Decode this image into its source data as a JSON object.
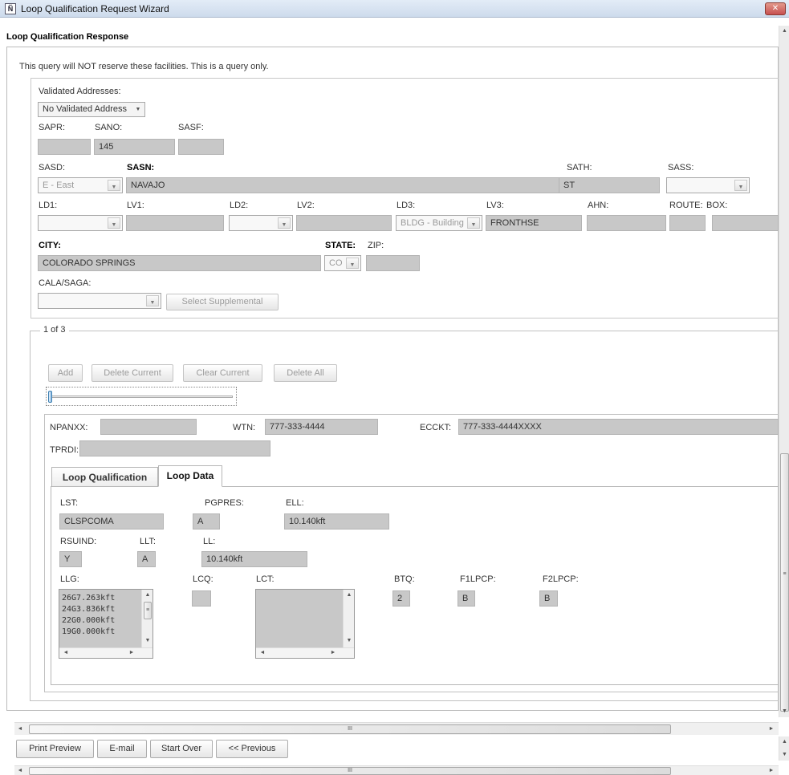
{
  "window": {
    "title": "Loop Qualification Request Wizard",
    "close_glyph": "✕"
  },
  "header": {
    "title": "Loop Qualification Response"
  },
  "notice": "This query will NOT reserve these facilities.  This is a query only.",
  "address": {
    "validated_label": "Validated Addresses:",
    "validated_value": "No Validated Address",
    "sapr_label": "SAPR:",
    "sapr_value": "",
    "sano_label": "SANO:",
    "sano_value": "145",
    "sasf_label": "SASF:",
    "sasf_value": "",
    "sasd_label": "SASD:",
    "sasd_value": "E - East",
    "sasn_label": "SASN:",
    "sasn_value": "NAVAJO",
    "sath_label": "SATH:",
    "sath_value": "ST",
    "sass_label": "SASS:",
    "sass_value": "",
    "ld1_label": "LD1:",
    "ld1_value": "",
    "lv1_label": "LV1:",
    "lv1_value": "",
    "ld2_label": "LD2:",
    "ld2_value": "",
    "lv2_label": "LV2:",
    "lv2_value": "",
    "ld3_label": "LD3:",
    "ld3_value": "BLDG - Building",
    "lv3_label": "LV3:",
    "lv3_value": "FRONTHSE",
    "ahn_label": "AHN:",
    "ahn_value": "",
    "route_label": "ROUTE:",
    "route_value": "",
    "box_label": "BOX:",
    "box_value": "",
    "city_label": "CITY:",
    "city_value": "COLORADO SPRINGS",
    "state_label": "STATE:",
    "state_value": "CO",
    "zip_label": "ZIP:",
    "zip_value": "",
    "cala_label": "CALA/SAGA:",
    "cala_value": "",
    "select_supplemental": "Select Supplemental"
  },
  "records": {
    "counter": "1 of 3",
    "add": "Add",
    "delete_current": "Delete Current",
    "clear_current": "Clear Current",
    "delete_all": "Delete All",
    "npanxx_label": "NPANXX:",
    "npanxx_value": "",
    "wtn_label": "WTN:",
    "wtn_value": "777-333-4444",
    "ecckt_label": "ECCKT:",
    "ecckt_value": "777-333-4444XXXX",
    "tprdi_label": "TPRDI:",
    "tprdi_value": ""
  },
  "tabs": [
    {
      "label": "Loop Qualification",
      "active": false
    },
    {
      "label": "Loop Data",
      "active": true
    }
  ],
  "loop_data": {
    "lst_label": "LST:",
    "lst_value": "CLSPCOMA",
    "pgpres_label": "PGPRES:",
    "pgpres_value": "A",
    "ell_label": "ELL:",
    "ell_value": "10.140kft",
    "rsuind_label": "RSUIND:",
    "rsuind_value": "Y",
    "llt_label": "LLT:",
    "llt_value": "A",
    "ll_label": "LL:",
    "ll_value": "10.140kft",
    "llg_label": "LLG:",
    "llg_items": [
      "26G7.263kft",
      "24G3.836kft",
      "22G0.000kft",
      "19G0.000kft"
    ],
    "lcq_label": "LCQ:",
    "lcq_value": "",
    "lct_label": "LCT:",
    "btq_label": "BTQ:",
    "btq_value": "2",
    "f1lpcp_label": "F1LPCP:",
    "f1lpcp_value": "B",
    "f2lpcp_label": "F2LPCP:",
    "f2lpcp_value": "B"
  },
  "scroll": {
    "grip": "III",
    "right_grip": "≡"
  },
  "footer": {
    "print_preview": "Print Preview",
    "email": "E-mail",
    "start_over": "Start Over",
    "previous": "<< Previous"
  },
  "colors": {
    "field_bg": "#c8c8c8",
    "title_bar": "#d7e4f2",
    "close_red": "#c75050"
  }
}
